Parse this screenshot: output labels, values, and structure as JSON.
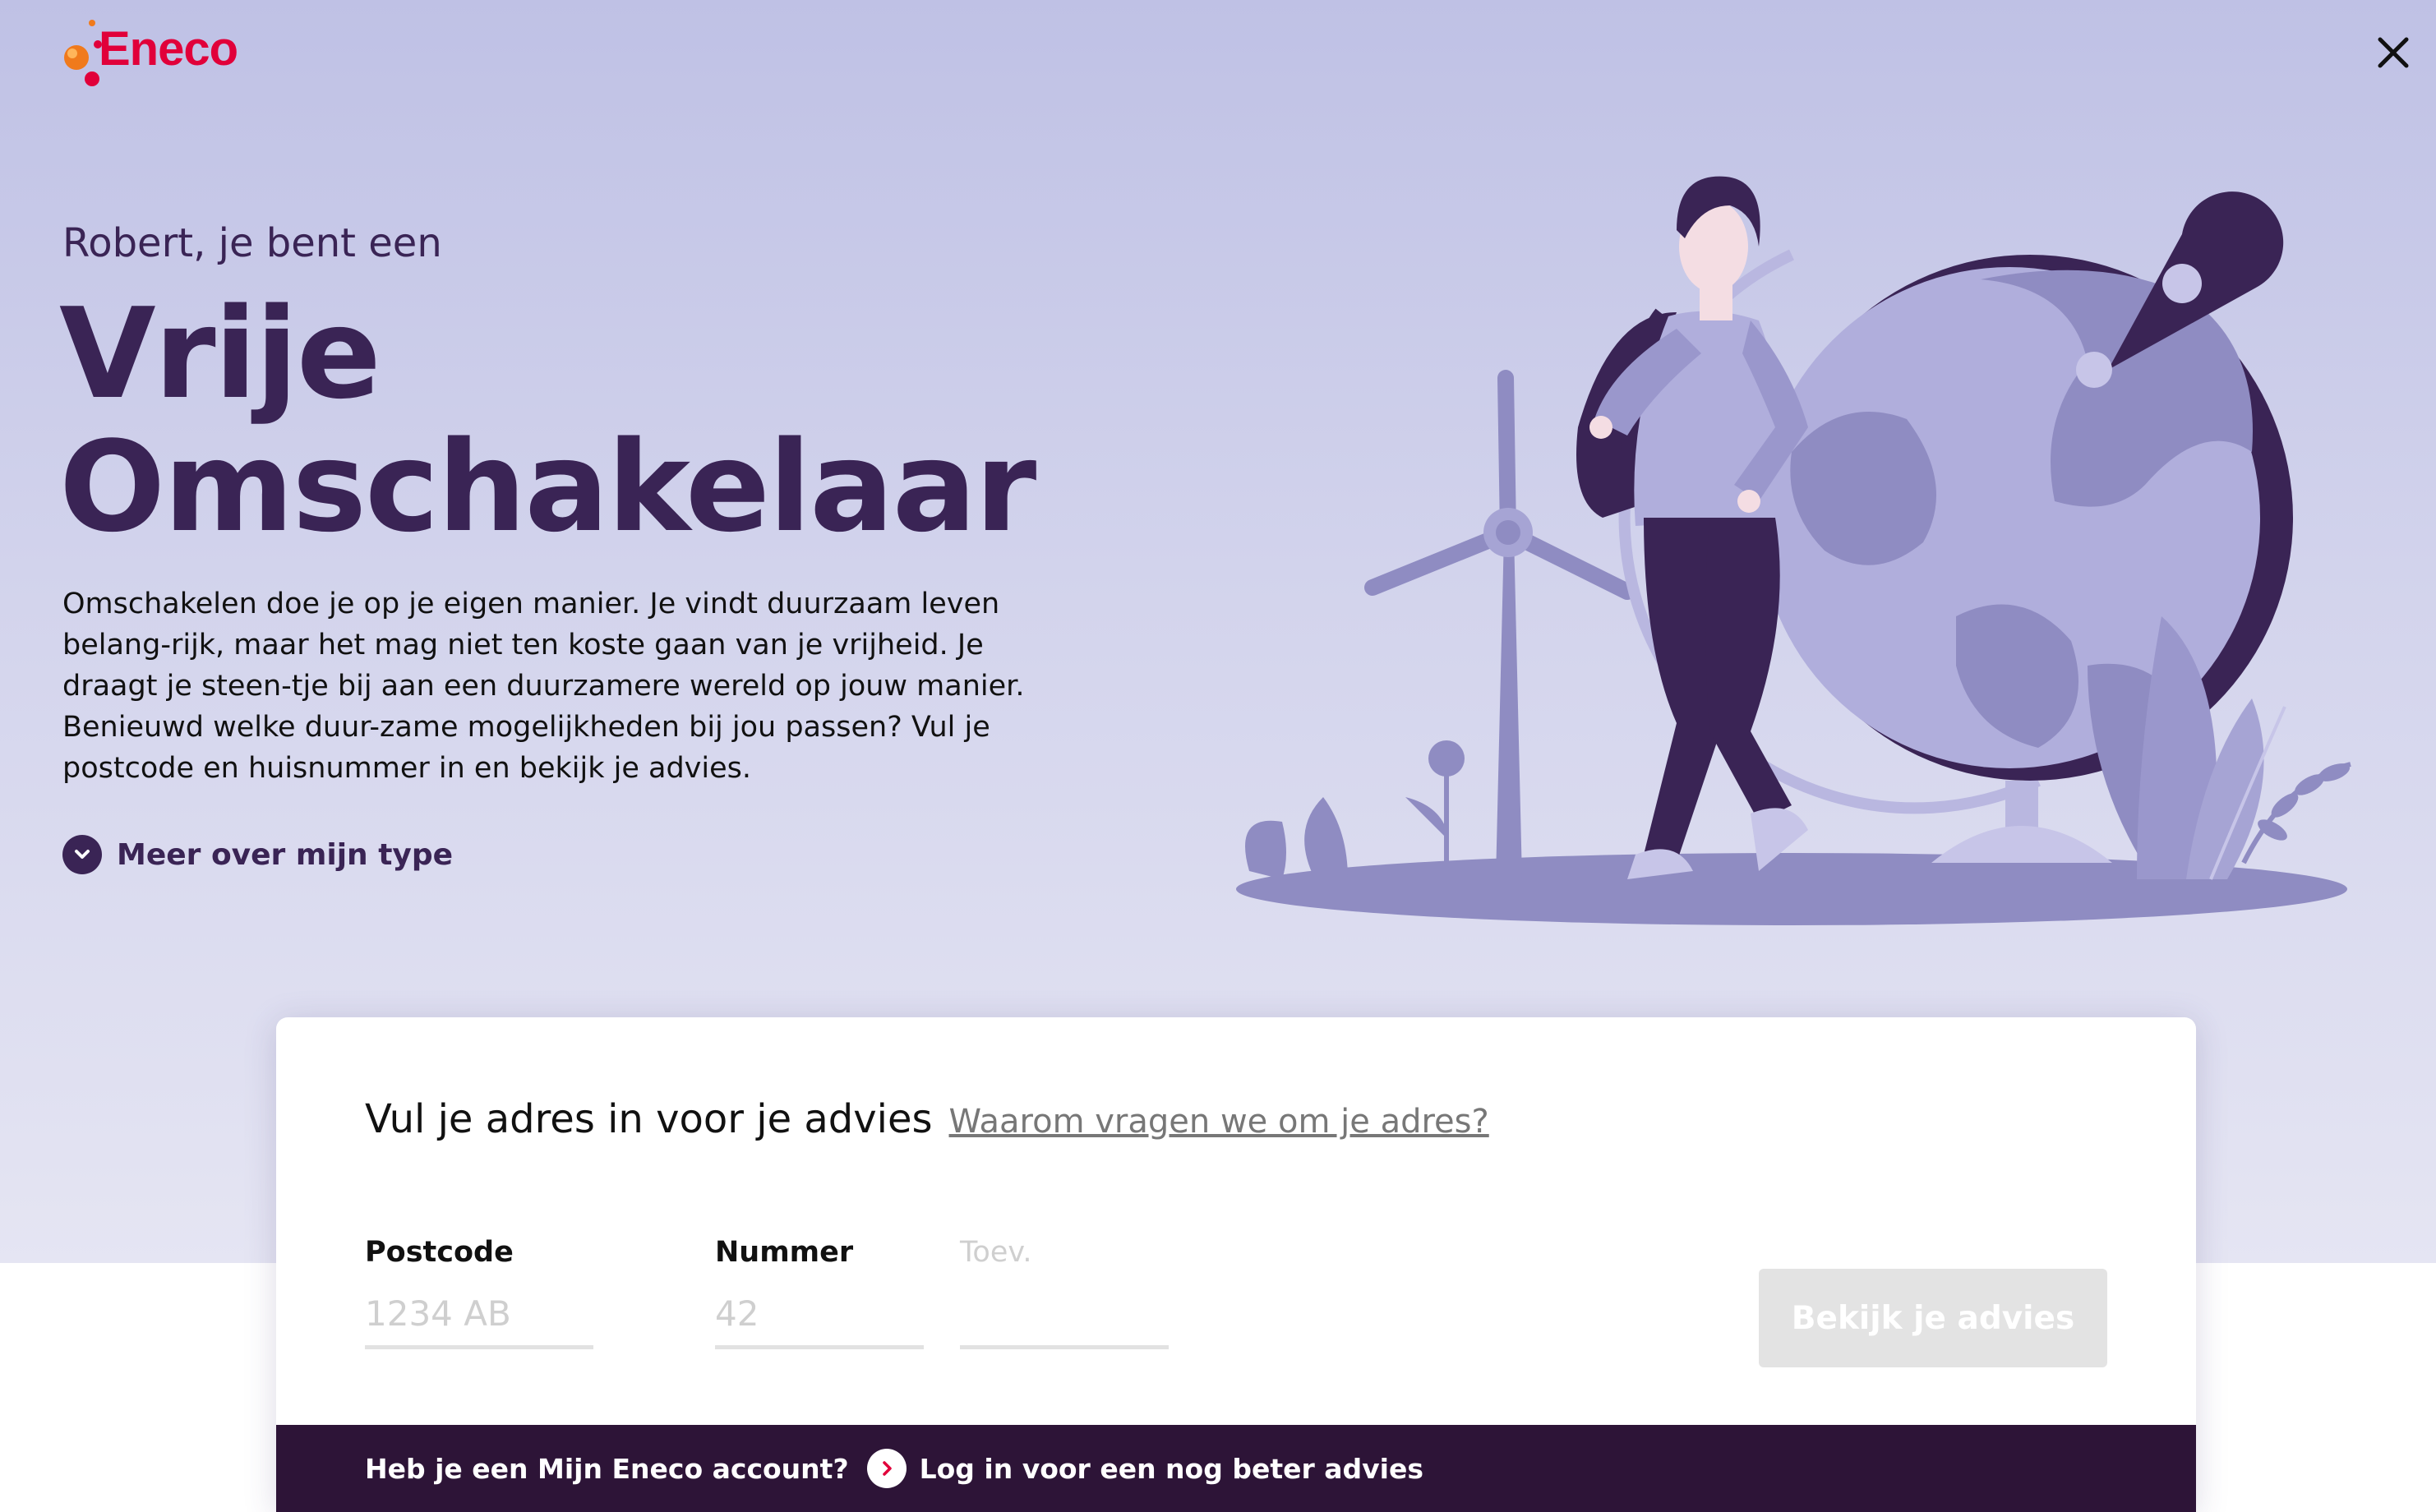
{
  "header": {
    "logo_text": "Eneco",
    "close_icon": "close-icon"
  },
  "hero": {
    "greeting": "Robert, je bent een",
    "type_line1": "Vrije",
    "type_line2": "Omschakelaar",
    "description": "Omschakelen doe je op je eigen manier. Je vindt duurzaam leven belang-rijk, maar het mag niet ten koste gaan van je vrijheid. Je draagt je steen-tje bij aan een duurzamere wereld op jouw manier. Benieuwd welke duur-zame mogelijkheden bij jou passen? Vul je postcode en huisnummer in en bekijk je advies.",
    "more_link": "Meer over mijn type",
    "more_icon": "chevron-down-icon"
  },
  "address_form": {
    "title": "Vul je adres in voor je advies",
    "why_link": "Waarom vragen we om je adres?",
    "postcode_label": "Postcode",
    "postcode_placeholder": "1234 AB",
    "number_label": "Nummer",
    "number_placeholder": "42",
    "addition_label": "Toev.",
    "submit_label": "Bekijk je advies"
  },
  "login_bar": {
    "question": "Heb je een Mijn Eneco account?",
    "link": "Log in voor een nog beter advies",
    "link_icon": "chevron-right-icon"
  },
  "colors": {
    "brand_red": "#e1003a",
    "primary_purple": "#3a2455",
    "login_bar_bg": "#2d1437",
    "hero_bg_top": "#bfc1e5",
    "disabled_button": "#e3e3e3"
  }
}
